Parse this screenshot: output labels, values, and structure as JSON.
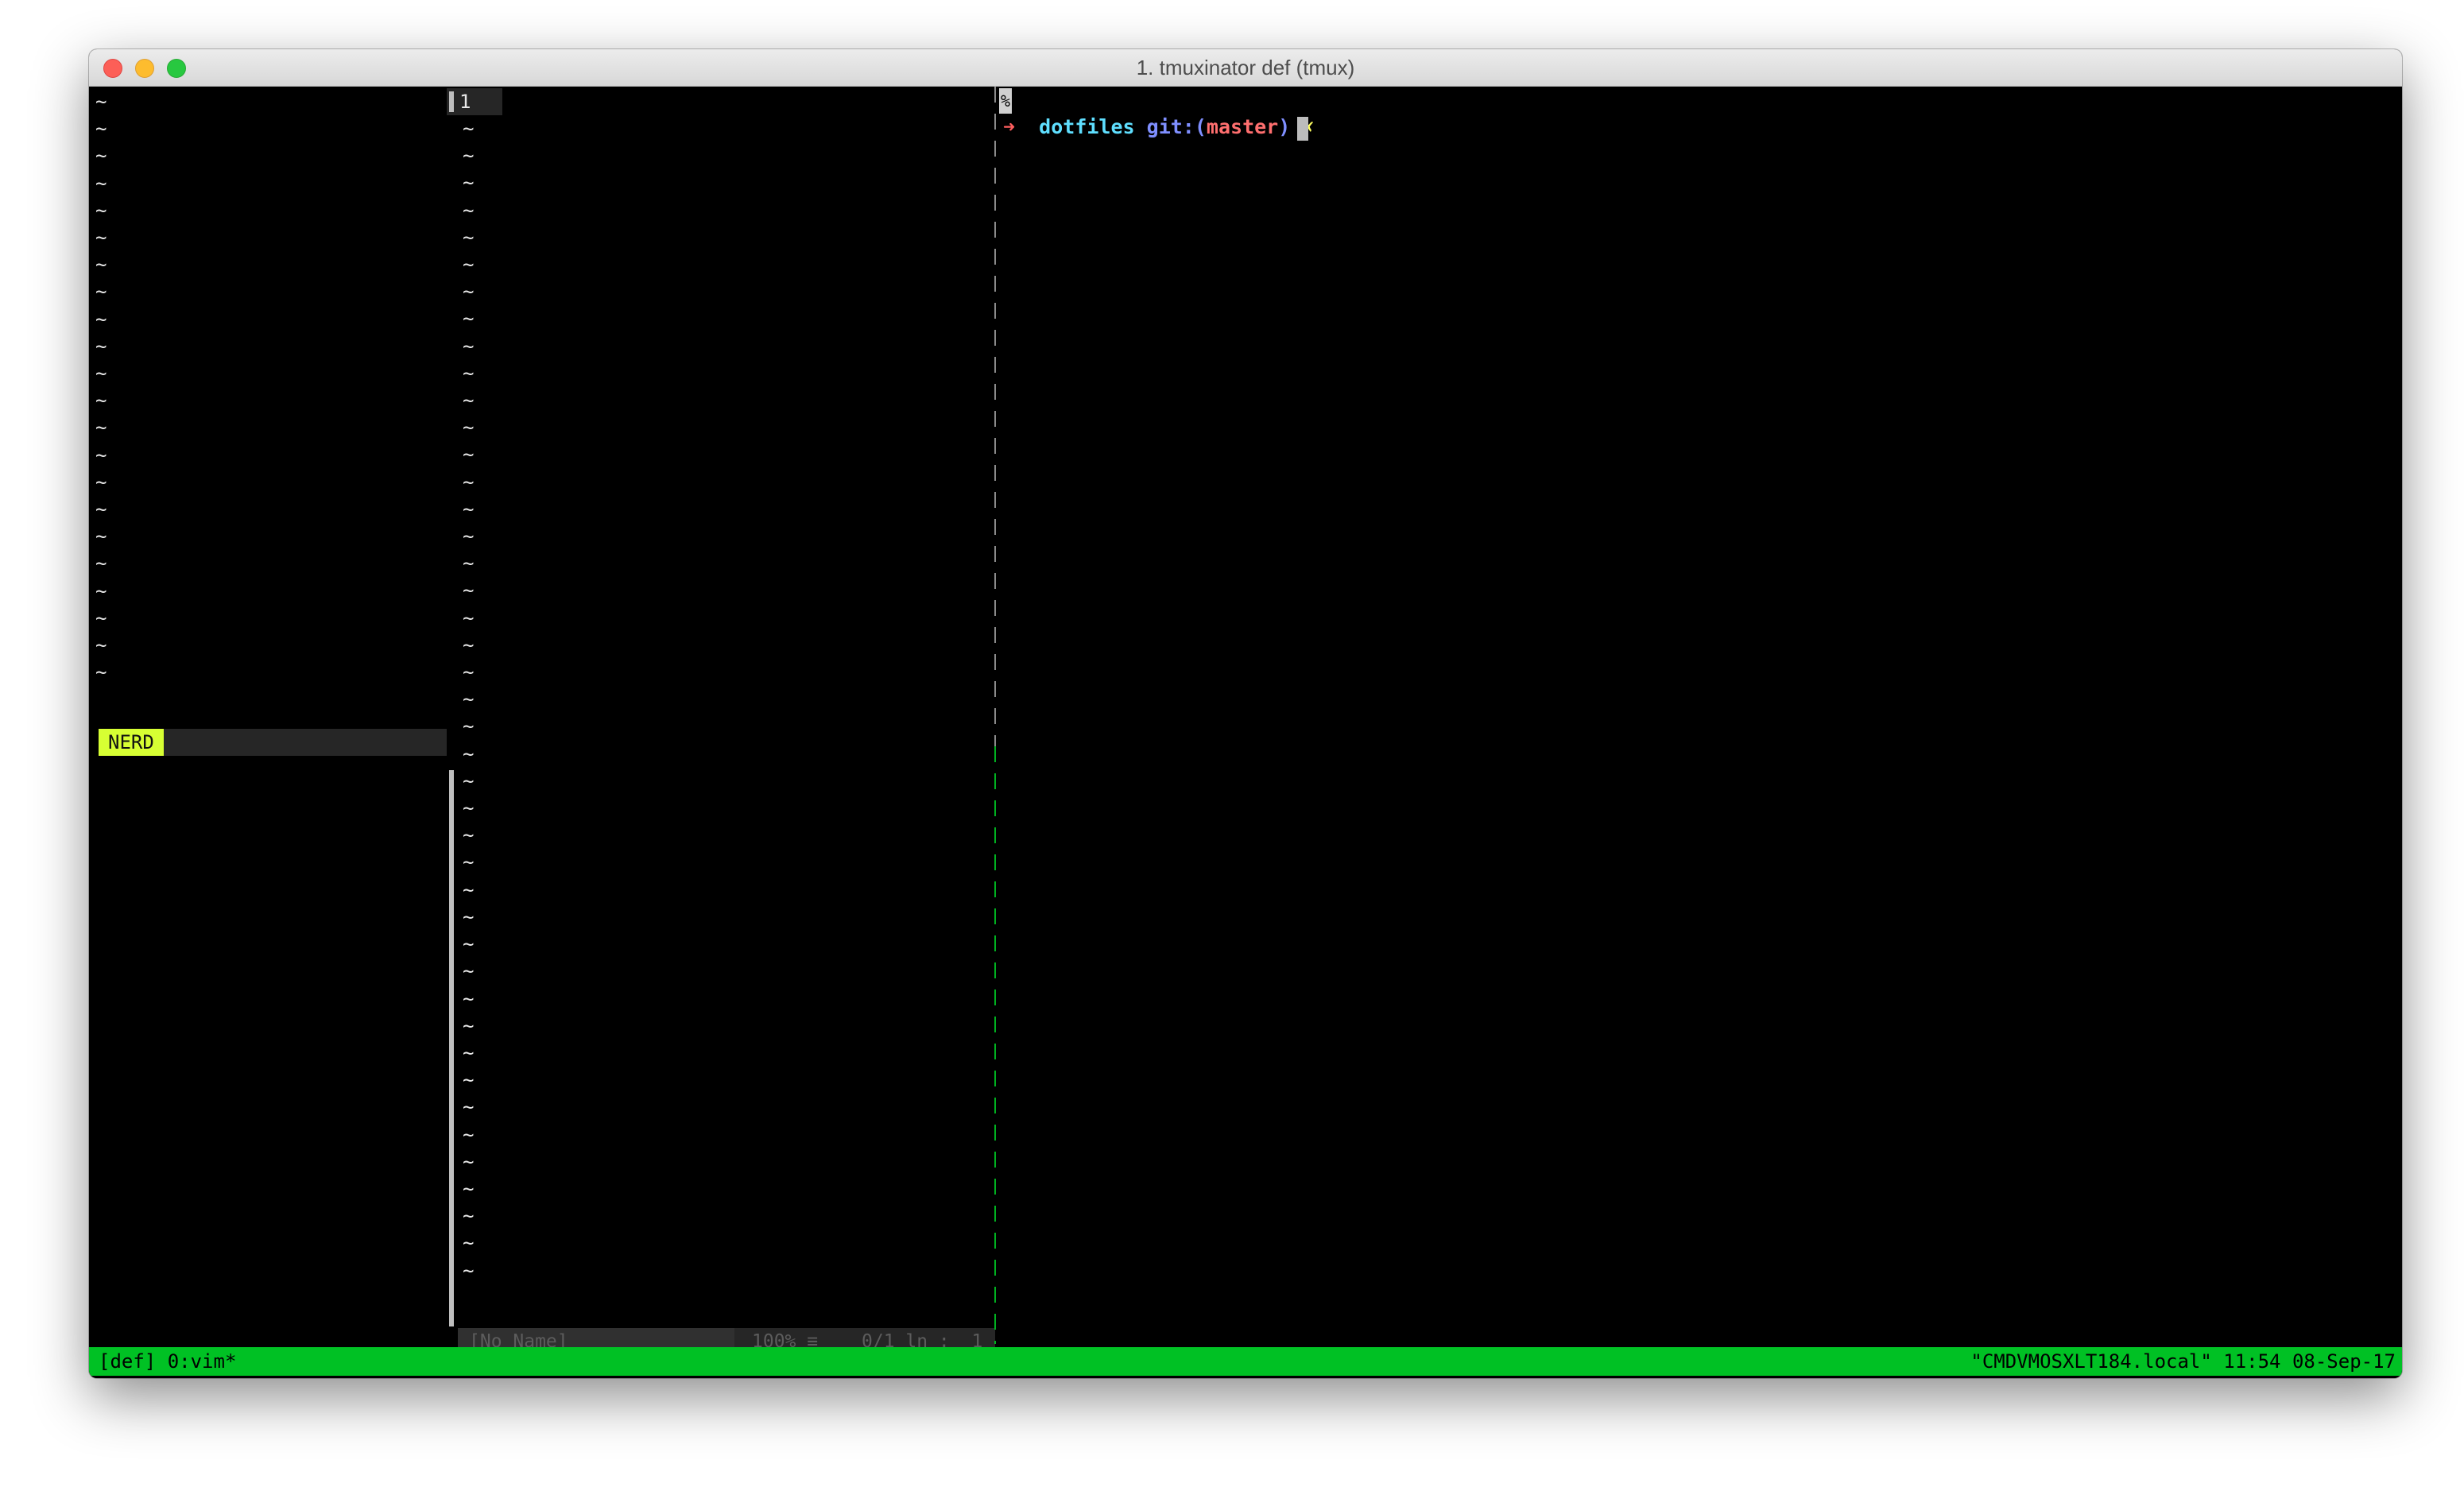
{
  "window": {
    "title": "1. tmuxinator def (tmux)"
  },
  "nerdtree": {
    "label": "NERD",
    "empty_line": "~"
  },
  "vim": {
    "line_number": "1",
    "empty_line": "~",
    "status": {
      "filename": "[No Name]",
      "percent": "100% ≡",
      "position": "0/1 ln :  1"
    }
  },
  "shell": {
    "pane_marker": "%",
    "prompt_arrow": "➜",
    "directory": "dotfiles",
    "git_prefix": "git:(",
    "branch": "master",
    "git_suffix": ")",
    "dirty_mark": "✗"
  },
  "tmux_status": {
    "left": "[def] 0:vim*",
    "right": "\"CMDVMOSXLT184.local\" 11:54 08-Sep-17"
  },
  "colors": {
    "status_green": "#00c124",
    "nerd_yellow": "#d7ff33",
    "prompt_red": "#ff5f5f",
    "dir_cyan": "#5fdfff",
    "git_blue": "#7f8fff",
    "branch_red": "#ff6f6f",
    "dirty_yellow": "#ffff5f",
    "divider_green": "#00b020"
  }
}
